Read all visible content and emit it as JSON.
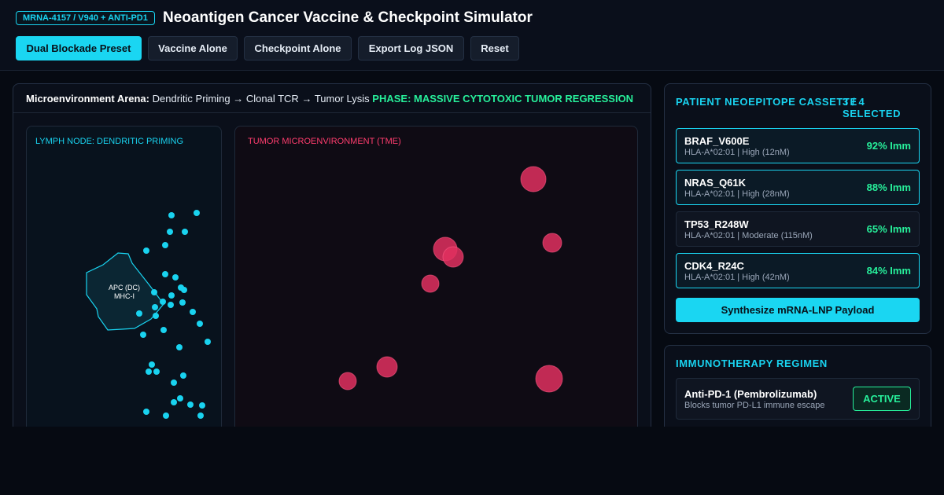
{
  "header": {
    "badge": "MRNA-4157 / V940 + ANTI-PD1",
    "title": "Neoantigen Cancer Vaccine & Checkpoint Simulator",
    "buttons": {
      "dual": "Dual Blockade Preset",
      "vaccine": "Vaccine Alone",
      "checkpoint": "Checkpoint Alone",
      "export": "Export Log JSON",
      "reset": "Reset"
    }
  },
  "arena": {
    "label": "Microenvironment Arena:",
    "steps": [
      "Dendritic Priming",
      "Clonal TCR",
      "Tumor Lysis"
    ],
    "arrow": "→",
    "phase": "PHASE: MASSIVE CYTOTOXIC TUMOR REGRESSION",
    "lymph_title": "LYMPH NODE: DENDRITIC PRIMING",
    "apc_line1": "APC (DC)",
    "apc_line2": "MHC-I",
    "tme_title": "TUMOR MICROENVIRONMENT (TME)"
  },
  "cassette": {
    "title": "PATIENT NEOEPITOPE CASSETTE",
    "count_line1": "3 / 4",
    "count_line2": "SELECTED",
    "epitopes": [
      {
        "name": "BRAF_V600E",
        "meta": "HLA-A*02:01 | High (12nM)",
        "imm": "92% Imm",
        "selected": true
      },
      {
        "name": "NRAS_Q61K",
        "meta": "HLA-A*02:01 | High (28nM)",
        "imm": "88% Imm",
        "selected": true
      },
      {
        "name": "TP53_R248W",
        "meta": "HLA-A*02:01 | Moderate (115nM)",
        "imm": "65% Imm",
        "selected": false
      },
      {
        "name": "CDK4_R24C",
        "meta": "HLA-A*02:01 | High (42nM)",
        "imm": "84% Imm",
        "selected": true
      }
    ],
    "synthesize": "Synthesize mRNA-LNP Payload"
  },
  "regimen": {
    "title": "IMMUNOTHERAPY REGIMEN",
    "item_name": "Anti-PD-1 (Pembrolizumab)",
    "item_desc": "Blocks tumor PD-L1 immune escape",
    "status": "ACTIVE"
  },
  "colors": {
    "accent": "#1ad6f2",
    "success": "#27f09b",
    "tumor": "#e0305f",
    "background": "#060a12"
  }
}
